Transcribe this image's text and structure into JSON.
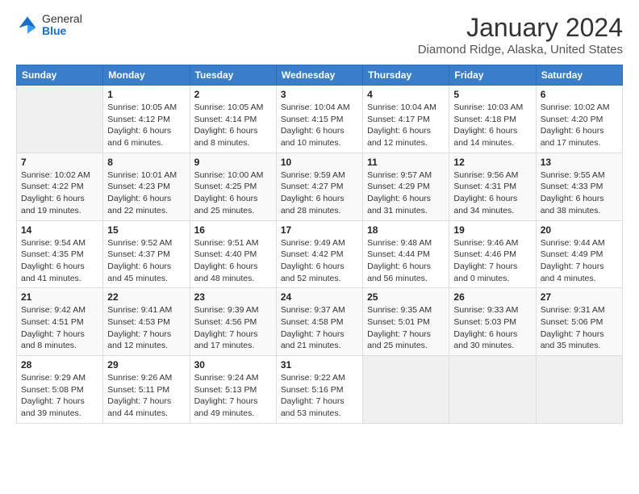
{
  "header": {
    "logo": {
      "general": "General",
      "blue": "Blue"
    },
    "title": "January 2024",
    "subtitle": "Diamond Ridge, Alaska, United States"
  },
  "calendar": {
    "days_of_week": [
      "Sunday",
      "Monday",
      "Tuesday",
      "Wednesday",
      "Thursday",
      "Friday",
      "Saturday"
    ],
    "weeks": [
      [
        {
          "num": "",
          "info": "",
          "empty": true
        },
        {
          "num": "1",
          "info": "Sunrise: 10:05 AM\nSunset: 4:12 PM\nDaylight: 6 hours\nand 6 minutes."
        },
        {
          "num": "2",
          "info": "Sunrise: 10:05 AM\nSunset: 4:14 PM\nDaylight: 6 hours\nand 8 minutes."
        },
        {
          "num": "3",
          "info": "Sunrise: 10:04 AM\nSunset: 4:15 PM\nDaylight: 6 hours\nand 10 minutes."
        },
        {
          "num": "4",
          "info": "Sunrise: 10:04 AM\nSunset: 4:17 PM\nDaylight: 6 hours\nand 12 minutes."
        },
        {
          "num": "5",
          "info": "Sunrise: 10:03 AM\nSunset: 4:18 PM\nDaylight: 6 hours\nand 14 minutes."
        },
        {
          "num": "6",
          "info": "Sunrise: 10:02 AM\nSunset: 4:20 PM\nDaylight: 6 hours\nand 17 minutes."
        }
      ],
      [
        {
          "num": "7",
          "info": "Sunrise: 10:02 AM\nSunset: 4:22 PM\nDaylight: 6 hours\nand 19 minutes."
        },
        {
          "num": "8",
          "info": "Sunrise: 10:01 AM\nSunset: 4:23 PM\nDaylight: 6 hours\nand 22 minutes."
        },
        {
          "num": "9",
          "info": "Sunrise: 10:00 AM\nSunset: 4:25 PM\nDaylight: 6 hours\nand 25 minutes."
        },
        {
          "num": "10",
          "info": "Sunrise: 9:59 AM\nSunset: 4:27 PM\nDaylight: 6 hours\nand 28 minutes."
        },
        {
          "num": "11",
          "info": "Sunrise: 9:57 AM\nSunset: 4:29 PM\nDaylight: 6 hours\nand 31 minutes."
        },
        {
          "num": "12",
          "info": "Sunrise: 9:56 AM\nSunset: 4:31 PM\nDaylight: 6 hours\nand 34 minutes."
        },
        {
          "num": "13",
          "info": "Sunrise: 9:55 AM\nSunset: 4:33 PM\nDaylight: 6 hours\nand 38 minutes."
        }
      ],
      [
        {
          "num": "14",
          "info": "Sunrise: 9:54 AM\nSunset: 4:35 PM\nDaylight: 6 hours\nand 41 minutes."
        },
        {
          "num": "15",
          "info": "Sunrise: 9:52 AM\nSunset: 4:37 PM\nDaylight: 6 hours\nand 45 minutes."
        },
        {
          "num": "16",
          "info": "Sunrise: 9:51 AM\nSunset: 4:40 PM\nDaylight: 6 hours\nand 48 minutes."
        },
        {
          "num": "17",
          "info": "Sunrise: 9:49 AM\nSunset: 4:42 PM\nDaylight: 6 hours\nand 52 minutes."
        },
        {
          "num": "18",
          "info": "Sunrise: 9:48 AM\nSunset: 4:44 PM\nDaylight: 6 hours\nand 56 minutes."
        },
        {
          "num": "19",
          "info": "Sunrise: 9:46 AM\nSunset: 4:46 PM\nDaylight: 7 hours\nand 0 minutes."
        },
        {
          "num": "20",
          "info": "Sunrise: 9:44 AM\nSunset: 4:49 PM\nDaylight: 7 hours\nand 4 minutes."
        }
      ],
      [
        {
          "num": "21",
          "info": "Sunrise: 9:42 AM\nSunset: 4:51 PM\nDaylight: 7 hours\nand 8 minutes."
        },
        {
          "num": "22",
          "info": "Sunrise: 9:41 AM\nSunset: 4:53 PM\nDaylight: 7 hours\nand 12 minutes."
        },
        {
          "num": "23",
          "info": "Sunrise: 9:39 AM\nSunset: 4:56 PM\nDaylight: 7 hours\nand 17 minutes."
        },
        {
          "num": "24",
          "info": "Sunrise: 9:37 AM\nSunset: 4:58 PM\nDaylight: 7 hours\nand 21 minutes."
        },
        {
          "num": "25",
          "info": "Sunrise: 9:35 AM\nSunset: 5:01 PM\nDaylight: 7 hours\nand 25 minutes."
        },
        {
          "num": "26",
          "info": "Sunrise: 9:33 AM\nSunset: 5:03 PM\nDaylight: 6 hours\nand 30 minutes."
        },
        {
          "num": "27",
          "info": "Sunrise: 9:31 AM\nSunset: 5:06 PM\nDaylight: 7 hours\nand 35 minutes."
        }
      ],
      [
        {
          "num": "28",
          "info": "Sunrise: 9:29 AM\nSunset: 5:08 PM\nDaylight: 7 hours\nand 39 minutes."
        },
        {
          "num": "29",
          "info": "Sunrise: 9:26 AM\nSunset: 5:11 PM\nDaylight: 7 hours\nand 44 minutes."
        },
        {
          "num": "30",
          "info": "Sunrise: 9:24 AM\nSunset: 5:13 PM\nDaylight: 7 hours\nand 49 minutes."
        },
        {
          "num": "31",
          "info": "Sunrise: 9:22 AM\nSunset: 5:16 PM\nDaylight: 7 hours\nand 53 minutes."
        },
        {
          "num": "",
          "info": "",
          "empty": true
        },
        {
          "num": "",
          "info": "",
          "empty": true
        },
        {
          "num": "",
          "info": "",
          "empty": true
        }
      ]
    ]
  }
}
